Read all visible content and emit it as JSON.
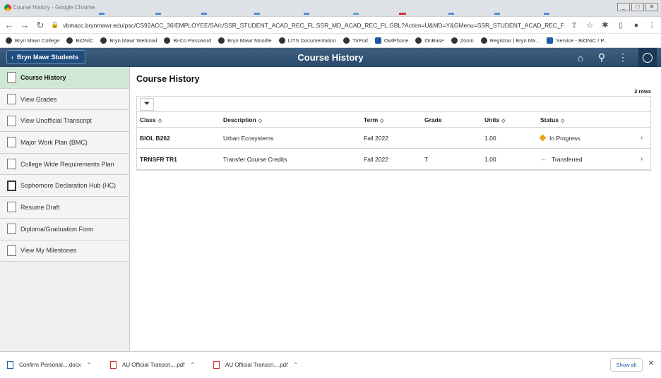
{
  "browser": {
    "window_title": "Course History - Google Chrome",
    "url": "vbmacc.brynmawr.edu/psc/CS92ACC_36/EMPLOYEE/SA/c/SSR_STUDENT_ACAD_REC_FL.SSR_MD_ACAD_REC_FL.GBL?Action=U&MD=Y&GMenu=SSR_STUDENT_ACAD_REC_FL&...",
    "bookmarks": [
      "Bryn Mawr College",
      "BiONiC",
      "Bryn Mawr Webmail",
      "Bi-Co Password",
      "Bryn Mawr Moodle",
      "LITS Documentation",
      "TriPod",
      "OwlPhone",
      "OnBase",
      "Zoom",
      "Registrar | Bryn Ma...",
      "Service - BiONiC / P..."
    ],
    "window_buttons": [
      "_",
      "□",
      "✕"
    ]
  },
  "header": {
    "back_label": "Bryn Mawr Students",
    "title": "Course History"
  },
  "sidebar": {
    "items": [
      {
        "label": "Course History"
      },
      {
        "label": "View Grades"
      },
      {
        "label": "View Unofficial Transcript"
      },
      {
        "label": "Major Work Plan (BMC)"
      },
      {
        "label": "College Wide Requirements Plan"
      },
      {
        "label": "Sophomore Declaration Hub (HC)"
      },
      {
        "label": "Resume Draft"
      },
      {
        "label": "Diploma/Graduation Form"
      },
      {
        "label": "View My Milestones"
      }
    ]
  },
  "main": {
    "title": "Course History",
    "row_count": "2 rows",
    "columns": [
      "Class",
      "Description",
      "Term",
      "Grade",
      "Units",
      "Status"
    ],
    "rows": [
      {
        "class": "BIOL B262",
        "description": "Urban Ecosystems",
        "term": "Fall 2022",
        "grade": "",
        "units": "1.00",
        "status": "In Progress"
      },
      {
        "class": "TRNSFR TR1",
        "description": "Transfer Course Credits",
        "term": "Fall 2022",
        "grade": "T",
        "units": "1.00",
        "status": "Transferred"
      }
    ]
  },
  "downloads": {
    "items": [
      "Confirm Personal....docx",
      "AU Official Transcri....pdf",
      "AU Official Transcri....pdf"
    ],
    "show_all": "Show all"
  },
  "colors": {
    "header": "#2a4a6c",
    "active_sidebar": "#cfe8d5",
    "status_in_progress": "#e8a317",
    "status_transferred": "#6a8a1a"
  }
}
